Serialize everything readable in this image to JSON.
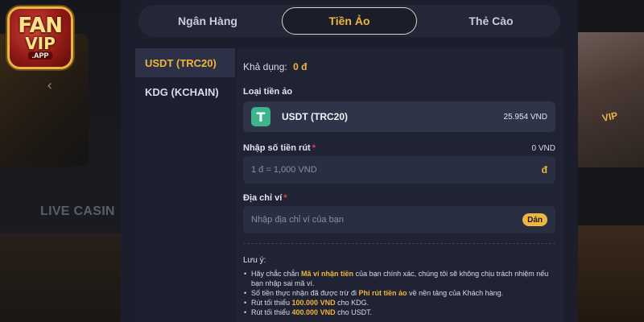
{
  "logo": {
    "line1": "FAN",
    "line2": "VIP",
    "suffix": ".APP"
  },
  "background": {
    "section_label": "LIVE CASIN",
    "arrow": "‹",
    "vip_tag": "VIP"
  },
  "tabs": [
    {
      "label": "Ngân Hàng",
      "active": false
    },
    {
      "label": "Tiền Ảo",
      "active": true
    },
    {
      "label": "Thẻ Cào",
      "active": false
    }
  ],
  "subnav": [
    {
      "label": "USDT (TRC20)",
      "active": true
    },
    {
      "label": "KDG (KCHAIN)",
      "active": false
    }
  ],
  "form": {
    "available_label": "Khả dụng:",
    "available_value": "0 đ",
    "coin_type_label": "Loại tiền ảo",
    "coin": {
      "icon_glyph": "T",
      "name": "USDT (TRC20)",
      "rate": "25.954 VND"
    },
    "amount_label": "Nhập số tiền rút",
    "amount_required": "*",
    "amount_converted": "0 VND",
    "amount_placeholder": "1 đ = 1,000 VND",
    "amount_suffix": "đ",
    "wallet_label": "Địa chỉ ví",
    "wallet_required": "*",
    "wallet_placeholder": "Nhập địa chỉ ví của bạn",
    "paste_label": "Dán"
  },
  "notes": {
    "title": "Lưu ý:",
    "n1_pre": "Hãy chắc chắn ",
    "n1_hl": "Mã ví nhận tiền",
    "n1_post": " của bạn chính xác, chúng tôi sẽ không chịu trách nhiệm nếu bạn nhập sai mã ví.",
    "n2_pre": "Số tiền thực nhận đã được trừ đi ",
    "n2_hl": "Phí rút tiền ảo",
    "n2_post": " về nền tảng của Khách hàng.",
    "n3_pre": "Rút tối thiểu ",
    "n3_hl": "100.000 VND",
    "n3_post": " cho KDG.",
    "n4_pre": "Rút tối thiểu ",
    "n4_hl": "400.000 VND",
    "n4_post": " cho USDT."
  },
  "colors": {
    "accent": "#f0b53c",
    "panel": "#1f2333",
    "required": "#e0483d",
    "tether": "#3cb58d"
  }
}
